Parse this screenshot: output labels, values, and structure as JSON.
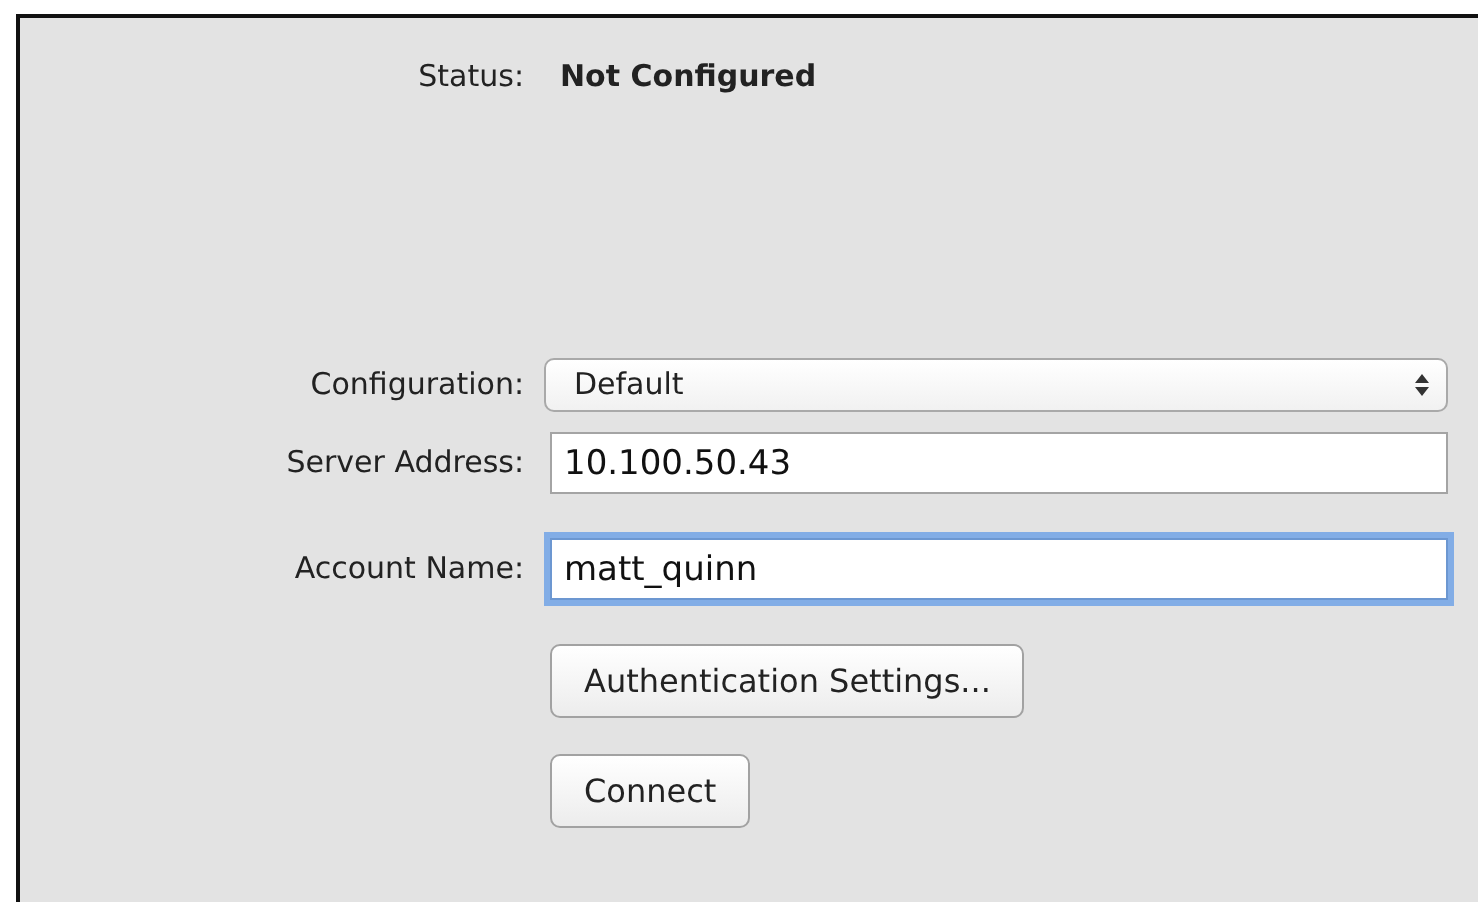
{
  "status": {
    "label": "Status:",
    "value": "Not Configured"
  },
  "fields": [
    {
      "kind": "select",
      "label": "Configuration:",
      "value": "Default"
    },
    {
      "kind": "text",
      "label": "Server Address:",
      "value": "10.100.50.43",
      "focused": false
    },
    {
      "kind": "text",
      "label": "Account Name:",
      "value": "matt_quinn",
      "focused": true
    }
  ],
  "buttons": [
    {
      "label": "Authentication Settings..."
    },
    {
      "label": "Connect"
    }
  ]
}
